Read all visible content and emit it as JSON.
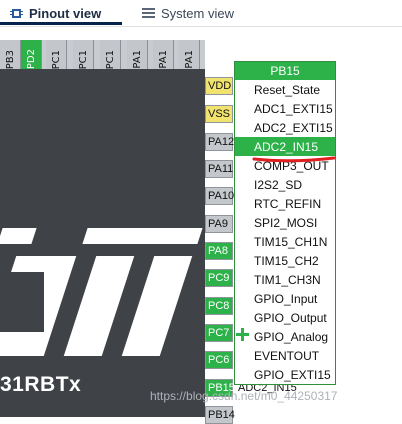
{
  "tabs": [
    {
      "label": "Pinout view",
      "icon": "pinout-icon",
      "active": true
    },
    {
      "label": "System view",
      "icon": "list-icon",
      "active": false
    }
  ],
  "top_pins": [
    "PB3",
    "PD2",
    "PC1",
    "PC1",
    "PC1",
    "PA1",
    "PA1",
    "PA1"
  ],
  "right_pins": [
    "VDD",
    "VSS",
    "PA12",
    "PA11",
    "PA10",
    "PA9",
    "PA8",
    "PC9",
    "PC8",
    "PC7",
    "PC6",
    "PB15",
    "PB14"
  ],
  "chip_label": "31RBTx",
  "dropdown": {
    "title": "PB15",
    "items": [
      "Reset_State",
      "ADC1_EXTI15",
      "ADC2_EXTI15",
      "ADC2_IN15",
      "COMP3_OUT",
      "I2S2_SD",
      "RTC_REFIN",
      "SPI2_MOSI",
      "TIM15_CH1N",
      "TIM15_CH2",
      "TIM1_CH3N",
      "GPIO_Input",
      "GPIO_Output",
      "GPIO_Analog",
      "EVENTOUT",
      "GPIO_EXTI15"
    ],
    "selected": "ADC2_IN15",
    "pin_label_below": "ADC2_IN15"
  },
  "watermark": "https://blog.csdn.net/m0_44250317",
  "colors": {
    "accent_green": "#2db24a",
    "chip_dark": "#3f4347",
    "annotation_red": "#e02020",
    "tab_underline": "#03234b"
  }
}
